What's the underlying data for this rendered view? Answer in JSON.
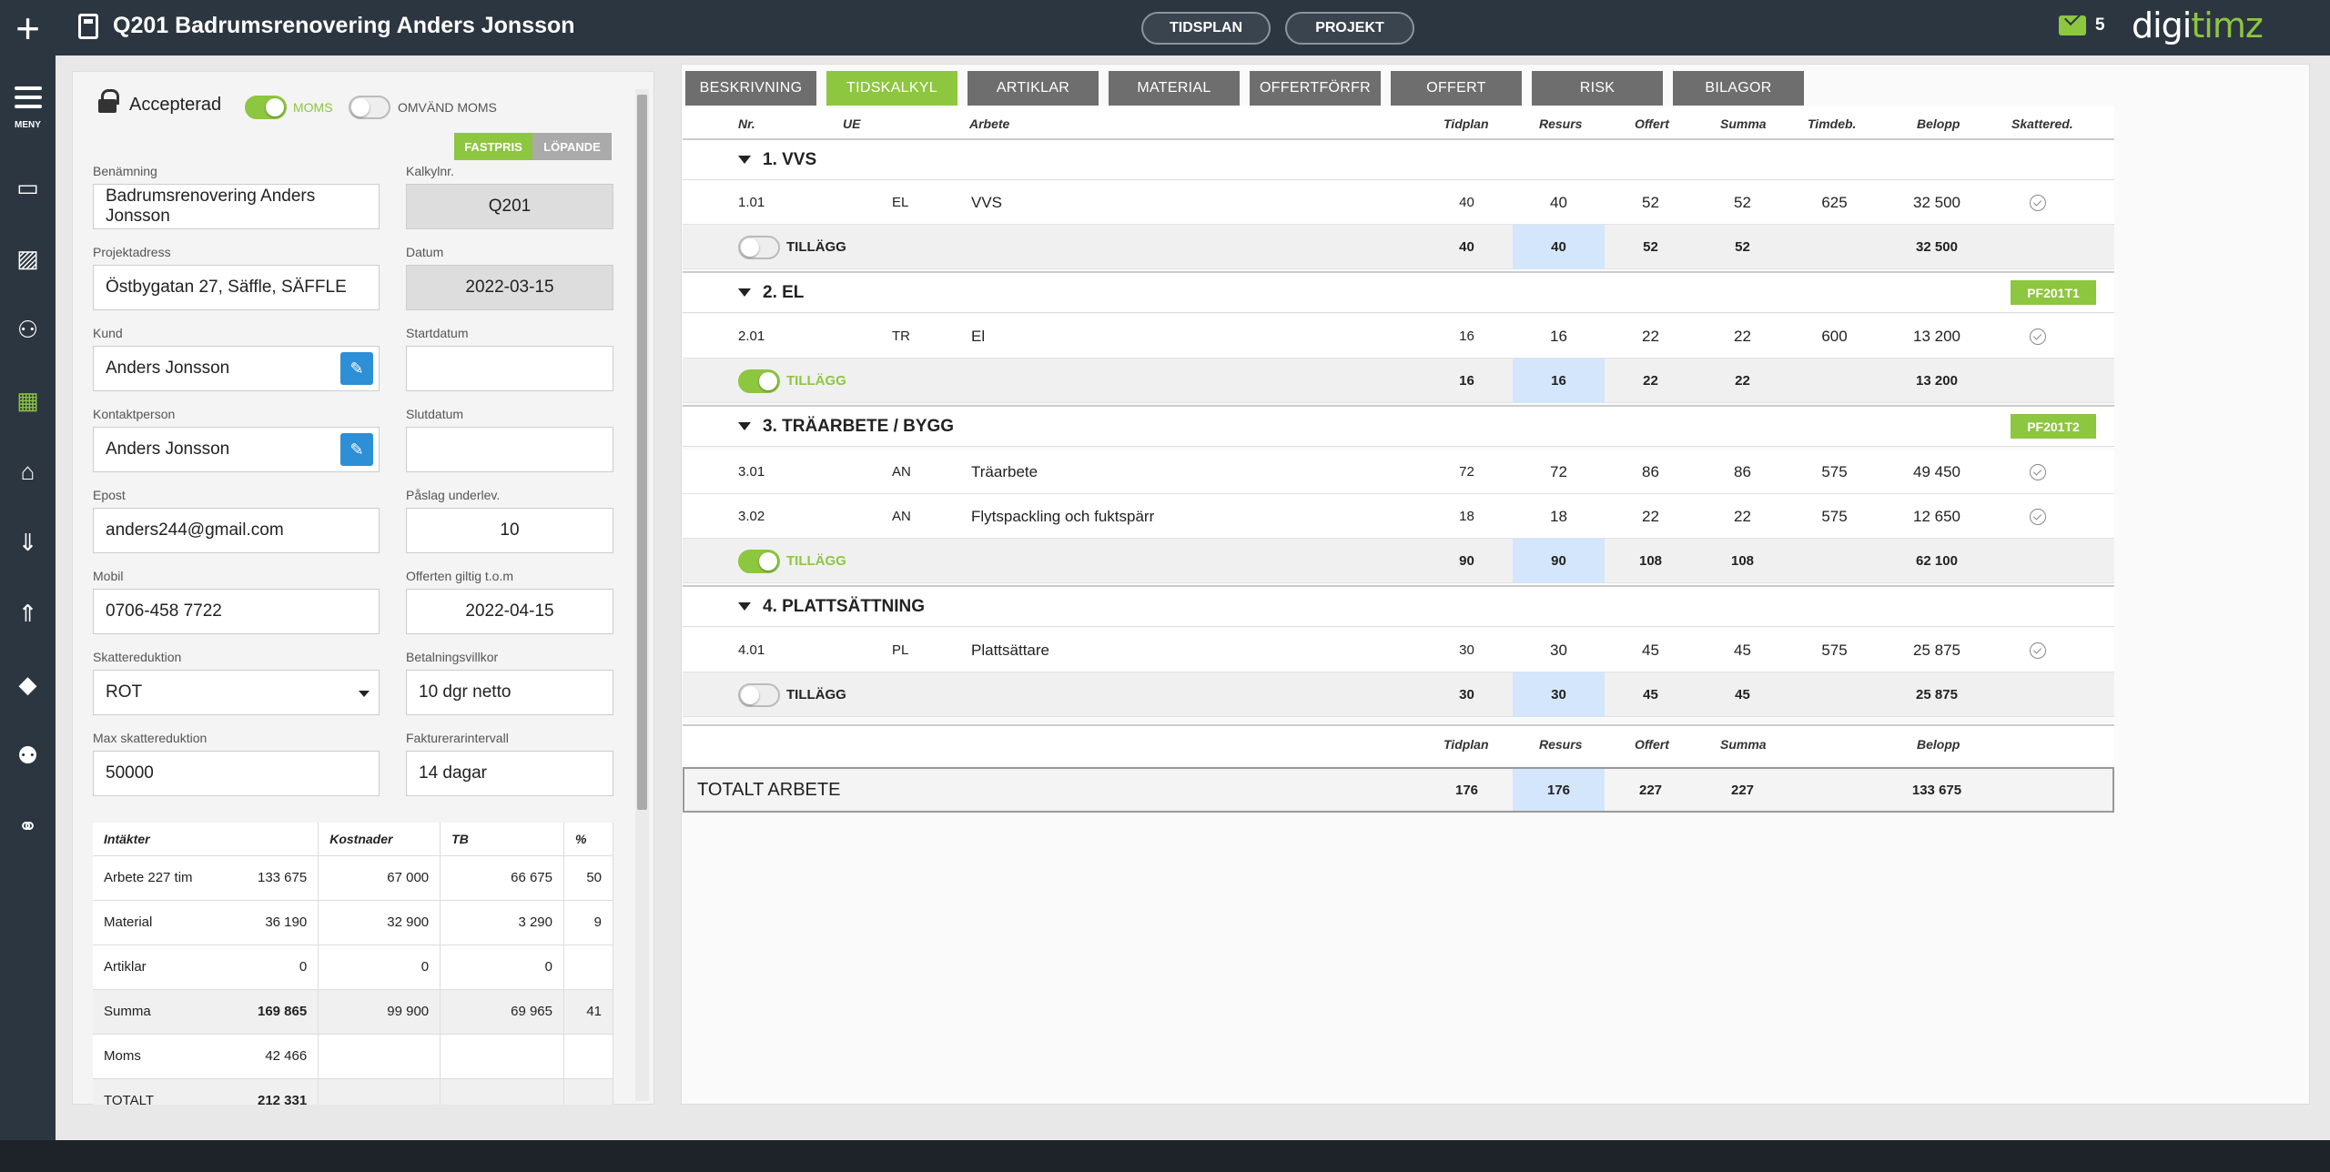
{
  "header": {
    "title": "Q201 Badrumsrenovering Anders Jonsson",
    "btn_tidsplan": "TIDSPLAN",
    "btn_projekt": "PROJEKT",
    "mail_count": "5",
    "logo_a": "digi",
    "logo_b": "timz"
  },
  "sidebar": {
    "meny_label": "MENY"
  },
  "form": {
    "status": "Accepterad",
    "moms_label": "MOMS",
    "omvand_label": "OMVÄND MOMS",
    "fastpris": "FASTPRIS",
    "lopande": "LÖPANDE",
    "benamning_label": "Benämning",
    "benamning": "Badrumsrenovering Anders Jonsson",
    "kalkylnr_label": "Kalkylnr.",
    "kalkylnr": "Q201",
    "adress_label": "Projektadress",
    "adress": "Östbygatan 27, Säffle, SÄFFLE",
    "datum_label": "Datum",
    "datum": "2022-03-15",
    "kund_label": "Kund",
    "kund": "Anders Jonsson",
    "startdatum_label": "Startdatum",
    "kontakt_label": "Kontaktperson",
    "kontakt": "Anders Jonsson",
    "slutdatum_label": "Slutdatum",
    "epost_label": "Epost",
    "epost": "anders244@gmail.com",
    "paslag_label": "Påslag underlev.",
    "paslag": "10",
    "mobil_label": "Mobil",
    "mobil": "0706-458 7722",
    "giltig_label": "Offerten giltig t.o.m",
    "giltig": "2022-04-15",
    "skatt_label": "Skattereduktion",
    "skatt": "ROT",
    "betalning_label": "Betalningsvillkor",
    "betalning": "10 dgr netto",
    "maxskatt_label": "Max skattereduktion",
    "maxskatt": "50000",
    "faktura_label": "Fakturerarintervall",
    "faktura": "14 dagar"
  },
  "summary": {
    "headers": [
      "Intäkter",
      "Kostnader",
      "TB",
      "%"
    ],
    "rows": [
      [
        "Arbete 227 tim",
        "133 675",
        "67 000",
        "66 675",
        "50"
      ],
      [
        "Material",
        "36 190",
        "32 900",
        "3 290",
        "9"
      ],
      [
        "Artiklar",
        "0",
        "0",
        "0",
        ""
      ],
      [
        "Summa",
        "169 865",
        "99 900",
        "69 965",
        "41"
      ],
      [
        "Moms",
        "42 466",
        "",
        "",
        ""
      ],
      [
        "TOTALT",
        "212 331",
        "",
        "",
        ""
      ]
    ]
  },
  "tabs": [
    "BESKRIVNING",
    "TIDSKALKYL",
    "ARTIKLAR",
    "MATERIAL",
    "OFFERTFÖRFR",
    "OFFERT",
    "RISK",
    "BILAGOR"
  ],
  "columns": {
    "nr": "Nr.",
    "ue": "UE",
    "arbete": "Arbete",
    "tidplan": "Tidplan",
    "resurs": "Resurs",
    "offert": "Offert",
    "summa": "Summa",
    "timdeb": "Timdeb.",
    "belopp": "Belopp",
    "skattered": "Skattered."
  },
  "sections": [
    {
      "title": "1.  VVS",
      "badge": "",
      "rows": [
        {
          "nr": "1.01",
          "ue": "EL",
          "arbete": "VVS",
          "tidplan": "40",
          "resurs": "40",
          "offert": "52",
          "summa": "52",
          "timdeb": "625",
          "belopp": "32 500"
        }
      ],
      "sub": {
        "label": "TILLÄGG",
        "on": false,
        "tidplan": "40",
        "resurs": "40",
        "offert": "52",
        "summa": "52",
        "belopp": "32 500"
      }
    },
    {
      "title": "2.  EL",
      "badge": "PF201T1",
      "rows": [
        {
          "nr": "2.01",
          "ue": "TR",
          "arbete": "El",
          "tidplan": "16",
          "resurs": "16",
          "offert": "22",
          "summa": "22",
          "timdeb": "600",
          "belopp": "13 200"
        }
      ],
      "sub": {
        "label": "TILLÄGG",
        "on": true,
        "tidplan": "16",
        "resurs": "16",
        "offert": "22",
        "summa": "22",
        "belopp": "13 200"
      }
    },
    {
      "title": "3.  TRÄARBETE / BYGG",
      "badge": "PF201T2",
      "rows": [
        {
          "nr": "3.01",
          "ue": "AN",
          "arbete": "Träarbete",
          "tidplan": "72",
          "resurs": "72",
          "offert": "86",
          "summa": "86",
          "timdeb": "575",
          "belopp": "49 450"
        },
        {
          "nr": "3.02",
          "ue": "AN",
          "arbete": "Flytspackling och fuktspärr",
          "tidplan": "18",
          "resurs": "18",
          "offert": "22",
          "summa": "22",
          "timdeb": "575",
          "belopp": "12 650"
        }
      ],
      "sub": {
        "label": "TILLÄGG",
        "on": true,
        "tidplan": "90",
        "resurs": "90",
        "offert": "108",
        "summa": "108",
        "belopp": "62 100"
      }
    },
    {
      "title": "4.  PLATTSÄTTNING",
      "badge": "",
      "rows": [
        {
          "nr": "4.01",
          "ue": "PL",
          "arbete": "Plattsättare",
          "tidplan": "30",
          "resurs": "30",
          "offert": "45",
          "summa": "45",
          "timdeb": "575",
          "belopp": "25 875"
        }
      ],
      "sub": {
        "label": "TILLÄGG",
        "on": false,
        "tidplan": "30",
        "resurs": "30",
        "offert": "45",
        "summa": "45",
        "belopp": "25 875"
      }
    }
  ],
  "footer": {
    "tidplan": "Tidplan",
    "resurs": "Resurs",
    "offert": "Offert",
    "summa": "Summa",
    "belopp": "Belopp",
    "total_label": "TOTALT ARBETE",
    "total_tidplan": "176",
    "total_resurs": "176",
    "total_offert": "227",
    "total_summa": "227",
    "total_belopp": "133 675"
  },
  "colors": {
    "accent": "#8dc63f",
    "edit_blue": "#2d8fd5",
    "resurs_bg": "#d4e6fb",
    "dark": "#2c3640"
  }
}
